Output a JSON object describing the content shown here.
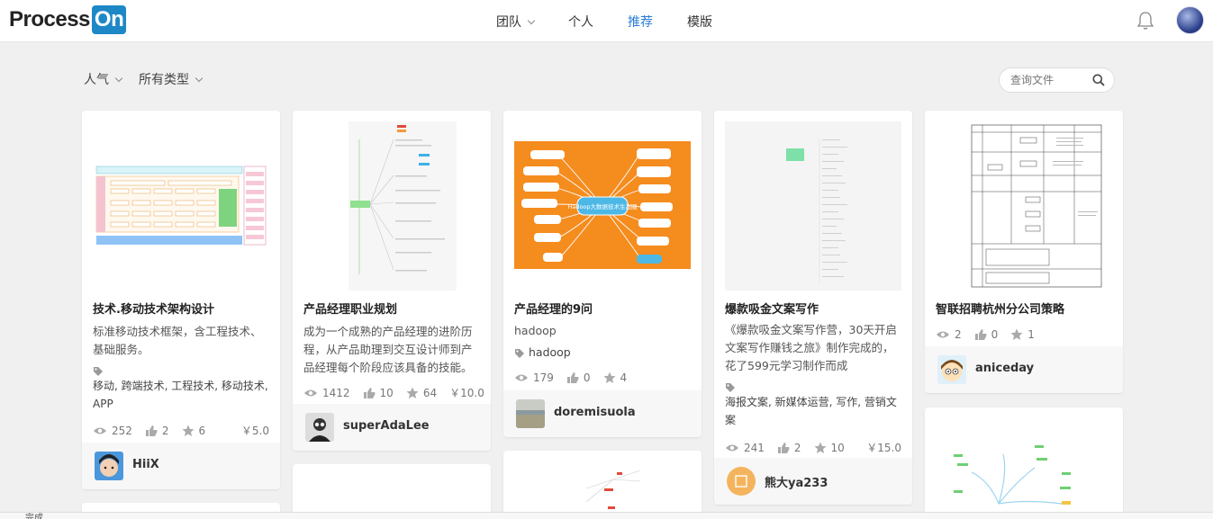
{
  "brand": {
    "name_part1": "Process",
    "name_part2": "On",
    "accent": "#1e88c7"
  },
  "nav": {
    "items": [
      {
        "label": "团队",
        "has_dropdown": true
      },
      {
        "label": "个人"
      },
      {
        "label": "推荐",
        "active": true
      },
      {
        "label": "模版"
      }
    ],
    "active_color": "#2b7dd6"
  },
  "filters": {
    "sort_label": "人气",
    "type_label": "所有类型"
  },
  "search": {
    "placeholder": "查询文件"
  },
  "cards": [
    {
      "title": "技术.移动技术架构设计",
      "desc": "标准移动技术框架，含工程技术、基础服务。",
      "tags": "移动, 跨端技术, 工程技术, 移动技术, APP",
      "views": "252",
      "likes": "2",
      "stars": "6",
      "price": "￥5.0",
      "author": "HiiX"
    },
    {
      "title": "产品经理职业规划",
      "desc": "成为一个成熟的产品经理的进阶历程，从产品助理到交互设计师到产品经理每个阶段应该具备的技能。",
      "views": "1412",
      "likes": "10",
      "stars": "64",
      "price": "￥10.0",
      "author": "superAdaLee"
    },
    {
      "title": "产品经理的9问",
      "desc": "hadoop",
      "tags": "hadoop",
      "thumb_center": "Hadoop大数据技术生态圈",
      "views": "179",
      "likes": "0",
      "stars": "4",
      "author": "doremisuola"
    },
    {
      "title": "爆款吸金文案写作",
      "desc": "《爆款吸金文案写作营，30天开启文案写作赚钱之旅》制作完成的，花了599元学习制作而成",
      "tags": "海报文案, 新媒体运营, 写作, 营销文案",
      "views": "241",
      "likes": "2",
      "stars": "10",
      "price": "￥15.0",
      "author": "熊大ya233"
    },
    {
      "title": "智联招聘杭州分公司策略",
      "views": "2",
      "likes": "0",
      "stars": "1",
      "author": "aniceday"
    }
  ],
  "statusbar": {
    "text": "完成"
  }
}
